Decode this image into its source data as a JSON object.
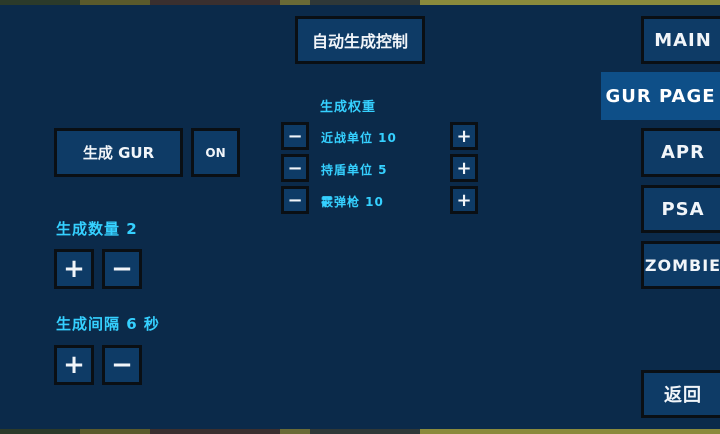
{
  "header": {
    "auto_spawn_control": "自动生成控制"
  },
  "spawn_button": {
    "label": "生成 GUR",
    "toggle": "ON"
  },
  "spawn_count": {
    "label": "生成数量 2",
    "plus": "+",
    "minus": "−"
  },
  "spawn_interval": {
    "label": "生成间隔 6 秒",
    "plus": "+",
    "minus": "−"
  },
  "weights": {
    "title": "生成权重",
    "rows": [
      {
        "label": "近战单位 10",
        "minus": "−",
        "plus": "+"
      },
      {
        "label": "持盾单位 5",
        "minus": "−",
        "plus": "+"
      },
      {
        "label": "霰弹枪 10",
        "minus": "−",
        "plus": "+"
      }
    ]
  },
  "nav": {
    "main": "MAIN",
    "gur_page": "GUR PAGE",
    "apr": "APR",
    "psa": "PSA",
    "zombie": "ZOMBIE",
    "back": "返回"
  },
  "colors": {
    "background": "#0b2a4a",
    "button": "#0e3b66",
    "accent_text": "#35d0ff",
    "active_nav": "#0e4f88"
  }
}
